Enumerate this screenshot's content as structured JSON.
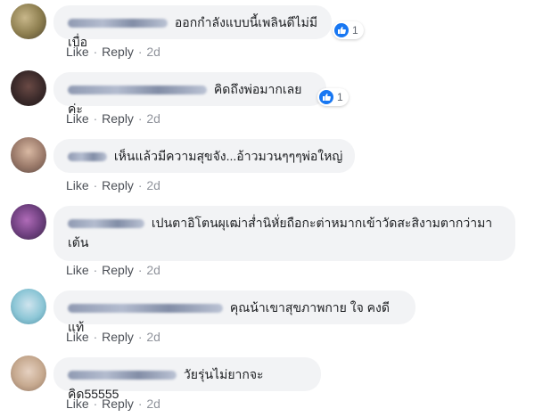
{
  "comments": [
    {
      "text": "ออกกำลังแบบนี้เพลินดีไม่มีเบื่อ",
      "reactions": "1",
      "like": "Like",
      "reply": "Reply",
      "time": "2d",
      "sep": "·"
    },
    {
      "text": "คิดถึงพ่อมากเลยค่ะ",
      "reactions": "1",
      "like": "Like",
      "reply": "Reply",
      "time": "2d",
      "sep": "·"
    },
    {
      "text": "เห็นแล้วมีความสุขจัง...อ้าวมวนๆๆๆพ่อใหญ่",
      "like": "Like",
      "reply": "Reply",
      "time": "2d",
      "sep": "·"
    },
    {
      "text_line1": "เปนตาอิโตนผุเฒ่าส่ำนิหั่ยถือกะต่าหมากเข้าวัดสะสิงามตากว่ามา",
      "text_line2": "เต้น",
      "like": "Like",
      "reply": "Reply",
      "time": "2d",
      "sep": "·"
    },
    {
      "text": "คุณน้าเขาสุขภาพกาย ใจ คงดีแท้",
      "like": "Like",
      "reply": "Reply",
      "time": "2d",
      "sep": "·"
    },
    {
      "text": "วัยรุ่นไม่ยากจะคิด55555",
      "like": "Like",
      "reply": "Reply",
      "time": "2d",
      "sep": "·"
    }
  ],
  "colors": {
    "bubble_bg": "#f2f3f5",
    "like_blue": "#1877f2",
    "action_text": "#4b4f56",
    "time_text": "#90949c"
  },
  "icons": [
    "blurred-avatar",
    "blurred-name",
    "like-icon"
  ]
}
